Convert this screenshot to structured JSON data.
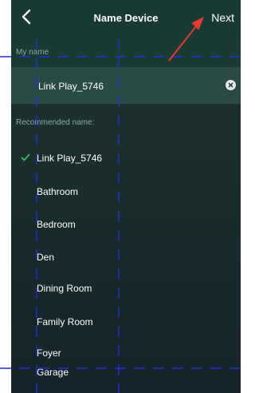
{
  "nav": {
    "title": "Name Device",
    "next_label": "Next"
  },
  "my_name": {
    "header": "My name",
    "value": "Link Play_5746"
  },
  "recommended": {
    "header": "Recommended name:",
    "items": [
      {
        "label": "Link Play_5746",
        "selected": true
      },
      {
        "label": "Bathroom",
        "selected": false
      },
      {
        "label": "Bedroom",
        "selected": false
      },
      {
        "label": "Den",
        "selected": false
      },
      {
        "label": "Dining Room",
        "selected": false
      },
      {
        "label": "Family Room",
        "selected": false
      },
      {
        "label": "Foyer",
        "selected": false
      },
      {
        "label": "Garage",
        "selected": false
      }
    ]
  },
  "colors": {
    "accent_check": "#3fc37a",
    "annotation_arrow": "#e53a2f",
    "annotation_dash": "#1f2fd6"
  },
  "icons": {
    "back": "chevron-left-icon",
    "clear": "clear-circle-icon",
    "check": "checkmark-icon"
  }
}
